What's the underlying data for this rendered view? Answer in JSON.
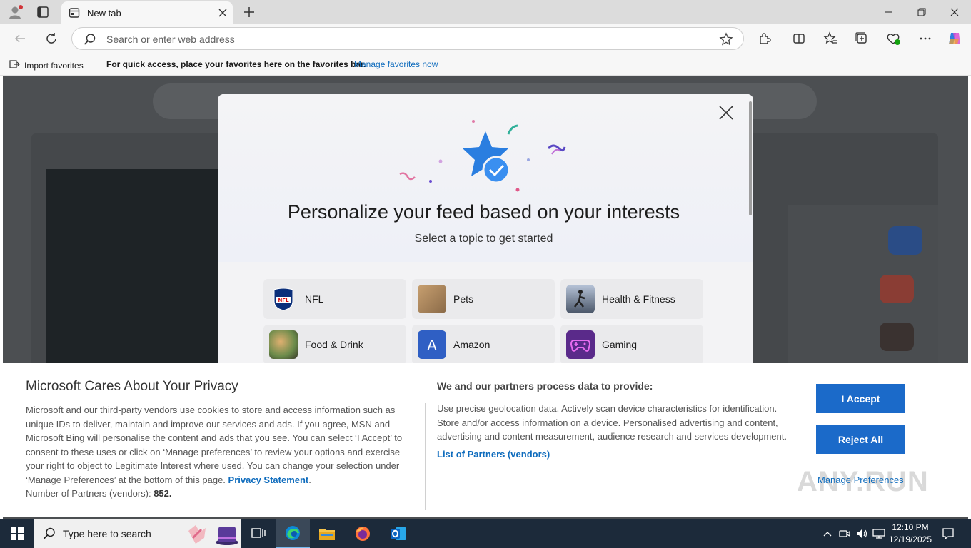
{
  "browser": {
    "tab_title": "New tab",
    "address_placeholder": "Search or enter web address",
    "favorites_bar": {
      "import_label": "Import favorites",
      "message": "For quick access, place your favorites here on the favorites bar.",
      "manage_link": "Manage favorites now"
    }
  },
  "modal": {
    "title": "Personalize your feed based on your interests",
    "subtitle": "Select a topic to get started",
    "topics": [
      {
        "label": "NFL"
      },
      {
        "label": "Pets"
      },
      {
        "label": "Health & Fitness"
      },
      {
        "label": "Food & Drink"
      },
      {
        "label": "Amazon"
      },
      {
        "label": "Gaming"
      }
    ]
  },
  "privacy": {
    "title": "Microsoft Cares About Your Privacy",
    "body": "Microsoft and our third-party vendors use cookies to store and access information such as unique IDs to deliver, maintain and improve our services and ads. If you agree, MSN and Microsoft Bing will personalise the content and ads that you see. You can select ‘I Accept’ to consent to these uses or click on ‘Manage preferences’ to review your options and exercise your right to object to Legitimate Interest where used.  You can change your selection under ‘Manage Preferences’ at the bottom of this page.",
    "privacy_link": "Privacy Statement",
    "partners_count_label": "Number of Partners (vendors):",
    "partners_count": "852.",
    "right_title": "We and our partners process data to provide:",
    "right_body": "Use precise geolocation data. Actively scan device characteristics for identification. Store and/or access information on a device. Personalised advertising and content, advertising and content measurement, audience research and services development.",
    "partners_link": "List of Partners (vendors)",
    "accept_label": "I Accept",
    "reject_label": "Reject All",
    "manage_label": "Manage Preferences",
    "watermark": "ANY.RUN"
  },
  "taskbar": {
    "search_placeholder": "Type here to search",
    "time": "12:10 PM",
    "date": "12/19/2025"
  },
  "colors": {
    "accent": "#1b6ac9",
    "link": "#0f6cbd",
    "taskbar": "#1c2a3a"
  }
}
